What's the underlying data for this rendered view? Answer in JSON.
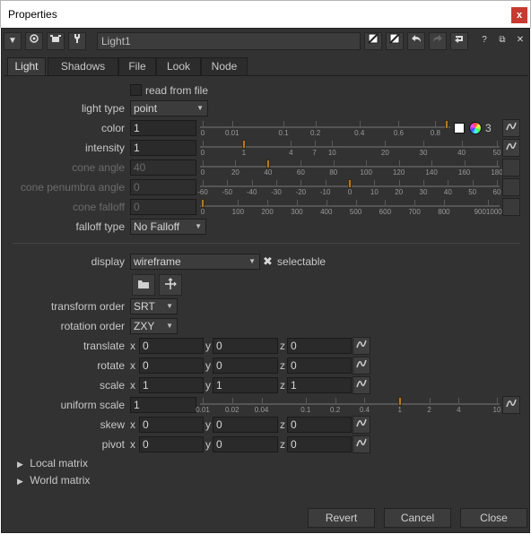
{
  "window": {
    "title": "Properties",
    "close_label": "x"
  },
  "toolbar": {
    "collapse_glyph": "▼",
    "node_name": "Light1",
    "help_glyph": "?",
    "float_glyph": "⧉",
    "close_glyph": "✕"
  },
  "tabs": [
    "Light",
    "Shadows",
    "File",
    "Look",
    "Node"
  ],
  "light": {
    "read_from_file_label": "read from file",
    "light_type": {
      "label": "light type",
      "value": "point"
    },
    "color": {
      "label": "color",
      "value": "1",
      "channels": "3",
      "ticks": [
        "0",
        "0.01",
        "0.1",
        "0.2",
        "0.4",
        "0.6",
        "0.8"
      ]
    },
    "intensity": {
      "label": "intensity",
      "value": "1",
      "ticks": [
        "0",
        "1",
        "4",
        "7",
        "10",
        "20",
        "30",
        "40",
        "50"
      ]
    },
    "cone_angle": {
      "label": "cone angle",
      "value": "40",
      "ticks": [
        "0",
        "20",
        "40",
        "60",
        "80",
        "100",
        "120",
        "140",
        "160",
        "180"
      ]
    },
    "cone_penumbra_angle": {
      "label": "cone penumbra angle",
      "value": "0",
      "ticks": [
        "-60",
        "-50",
        "-40",
        "-30",
        "-20",
        "-10",
        "0",
        "10",
        "20",
        "30",
        "40",
        "50",
        "60"
      ]
    },
    "cone_falloff": {
      "label": "cone falloff",
      "value": "0",
      "ticks": [
        "0",
        "100",
        "200",
        "300",
        "400",
        "500",
        "600",
        "700",
        "800",
        "9001000"
      ]
    },
    "falloff_type": {
      "label": "falloff type",
      "value": "No Falloff"
    }
  },
  "transform": {
    "display": {
      "label": "display",
      "value": "wireframe"
    },
    "selectable_label": "selectable",
    "transform_order": {
      "label": "transform order",
      "value": "SRT"
    },
    "rotation_order": {
      "label": "rotation order",
      "value": "ZXY"
    },
    "axis_labels": {
      "x": "x",
      "y": "y",
      "z": "z"
    },
    "translate": {
      "label": "translate",
      "x": "0",
      "y": "0",
      "z": "0"
    },
    "rotate": {
      "label": "rotate",
      "x": "0",
      "y": "0",
      "z": "0"
    },
    "scale": {
      "label": "scale",
      "x": "1",
      "y": "1",
      "z": "1"
    },
    "uniform_scale": {
      "label": "uniform scale",
      "value": "1",
      "ticks": [
        "0.01",
        "0.02",
        "0.04",
        "0.1",
        "0.2",
        "0.4",
        "1",
        "2",
        "4",
        "10"
      ]
    },
    "skew": {
      "label": "skew",
      "x": "0",
      "y": "0",
      "z": "0"
    },
    "pivot": {
      "label": "pivot",
      "x": "0",
      "y": "0",
      "z": "0"
    },
    "local_matrix_label": "Local matrix",
    "world_matrix_label": "World matrix"
  },
  "footer": {
    "revert": "Revert",
    "cancel": "Cancel",
    "close": "Close"
  }
}
